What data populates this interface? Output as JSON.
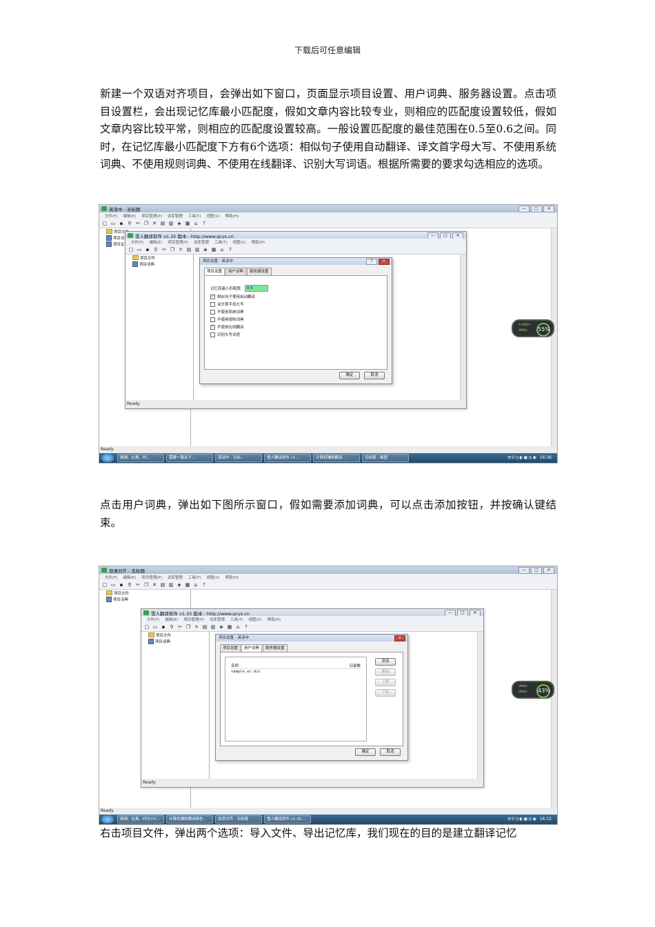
{
  "header": "下载后可任意编辑",
  "paragraphs": {
    "p1": "新建一个双语对齐项目，会弹出如下窗口，页面显示项目设置、用户词典、服务器设置。点击项目设置栏，会出现记忆库最小匹配度，假如文章内容比较专业，则相应的匹配度设置较低，假如文章内容比较平常，则相应的匹配度设置较高。一般设置匹配度的最佳范围在0.5至0.6之间。同时，在记忆库最小匹配度下方有6个选项：相似句子使用自动翻译、译文首字母大写、不使用系统词典、不使用规则词典、不使用在线翻译、识别大写词语。根据所需要的要求勾选相应的选项。",
    "p2": "点击用户词典，弹出如下图所示窗口，假如需要添加词典，可以点击添加按钮，并按确认键结束。",
    "p3": "右击项目文件，弹出两个选项：导入文件、导出记忆库，我们现在的目的是建立翻译记忆"
  },
  "shot1": {
    "title": "英译中 - 无标题",
    "menu": [
      "文件(F)",
      "编辑(E)",
      "项目管理(P)",
      "词库管理",
      "工具(T)",
      "视图(V)",
      "帮助(H)"
    ],
    "tree": [
      "项目文件",
      "项目词典",
      "项目证书"
    ],
    "status": "Ready",
    "gadget": {
      "up": "0.1KB/s",
      "down": "0KB/s",
      "pct": "55%"
    },
    "inner": {
      "title": "雪人翻译软件 v1.35 版本 - http://www.gcys.cn",
      "menu": [
        "文件(F)",
        "编辑(E)",
        "项目管理(P)",
        "词库管理",
        "工具(T)",
        "视图(V)",
        "帮助(H)"
      ],
      "tree": [
        "项目文件",
        "项目词典"
      ],
      "status": "Ready"
    },
    "dialog": {
      "title": "项目设置 - 英译中",
      "tabs": [
        "项目设置",
        "用户词典",
        "服务器设置"
      ],
      "min_match_label": "记忆库最小匹配度:",
      "min_match_value": "0.6",
      "options": [
        {
          "label": "相似句子使用自动翻译",
          "checked": true
        },
        {
          "label": "译文首字母大写",
          "checked": false
        },
        {
          "label": "不使用系统词典",
          "checked": false
        },
        {
          "label": "不使用规则词典",
          "checked": false
        },
        {
          "label": "不使用在线翻译",
          "checked": true
        },
        {
          "label": "识别大写词语",
          "checked": false
        }
      ],
      "ok": "确定",
      "cancel": "取消"
    },
    "taskbar": [
      "奥姆、比奥、时...",
      "需要一篇关于...",
      "英译中 - 无标...",
      "雪人翻译软件 v1...",
      "计算机辅助翻译...",
      "无标题 - 画图"
    ],
    "clock": "16:36"
  },
  "shot2": {
    "title": "双语对齐 - 无标题",
    "menu": [
      "文件(F)",
      "编辑(E)",
      "项目管理(P)",
      "词库管理",
      "工具(T)",
      "视图(V)",
      "帮助(H)"
    ],
    "tree": [
      "项目文件",
      "项目词典"
    ],
    "status": "Ready",
    "gadget": {
      "up": "0KB/s",
      "down": "0KB/s",
      "pct": "43%"
    },
    "inner": {
      "title": "雪人翻译软件 v1.35 版本 - http://www.gcys.cn",
      "menu": [
        "文件(F)",
        "编辑(E)",
        "项目管理(P)",
        "词库管理",
        "工具(T)",
        "视图(V)",
        "帮助(H)"
      ],
      "tree": [
        "项目文件",
        "项目词典"
      ],
      "status": "Ready"
    },
    "dialog": {
      "title": "项目设置 - 英译中",
      "tabs": [
        "项目设置",
        "用户词典",
        "服务器设置"
      ],
      "col_name": "名称",
      "col_count": "记录数",
      "row": "sample_ec.dic",
      "buttons": {
        "add": "添加",
        "delete": "删除",
        "up": "上移",
        "down": "下移"
      },
      "ok": "确定",
      "cancel": "取消"
    },
    "taskbar": [
      "奥姆、比奥、时光小C...",
      "计算机辅助翻译报告...",
      "双语对齐 - 无标题",
      "雪人翻译软件 v1.35..."
    ],
    "clock": "16:12"
  }
}
